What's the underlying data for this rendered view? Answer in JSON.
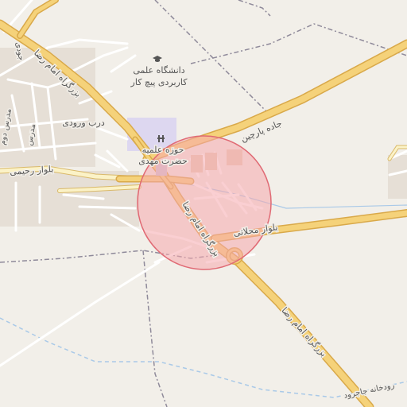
{
  "map": {
    "colors": {
      "land": "#f2efe9",
      "major_road": "#f5d27a",
      "major_road_casing": "#d9a94a",
      "secondary_road": "#fbf2c7",
      "minor_road": "#ffffff",
      "boundary": "#8f8a9a",
      "water": "#a9c9e8",
      "building": "#e2d9d0",
      "religious_area": "#ddd7f0",
      "green": "#cde8c2",
      "highlight_fill": "#f6a7ad",
      "highlight_stroke": "#e06a74"
    },
    "labels": {
      "boulevard_imam_reza_upper": "بزرگراه امام رضا",
      "boulevard_imam_reza_lower": "بزرگراه امام رضا",
      "boulevard_imam_reza_mid": "بزرگراه امام رضا",
      "university": "دانشگاه علمی",
      "university_line2": "کاربردی پیچ کار",
      "seminary": "حوزه علمیه",
      "seminary_line2": "حضرت مهدی",
      "darb_voroodi": "درب ورودی",
      "parchin_road": "جاده پارچین",
      "mahallati_blvd": "بلوار محلاتی",
      "rahimi_blvd": "بلوار رحیمی",
      "jajrood_river": "رودخانه جاجرود",
      "street_madras": "مدرس",
      "street_madras2": "مدرس دوم",
      "street_joodi": "جودی"
    },
    "icons": {
      "university": "graduation-cap-icon",
      "seminary": "religious-school-icon"
    }
  }
}
